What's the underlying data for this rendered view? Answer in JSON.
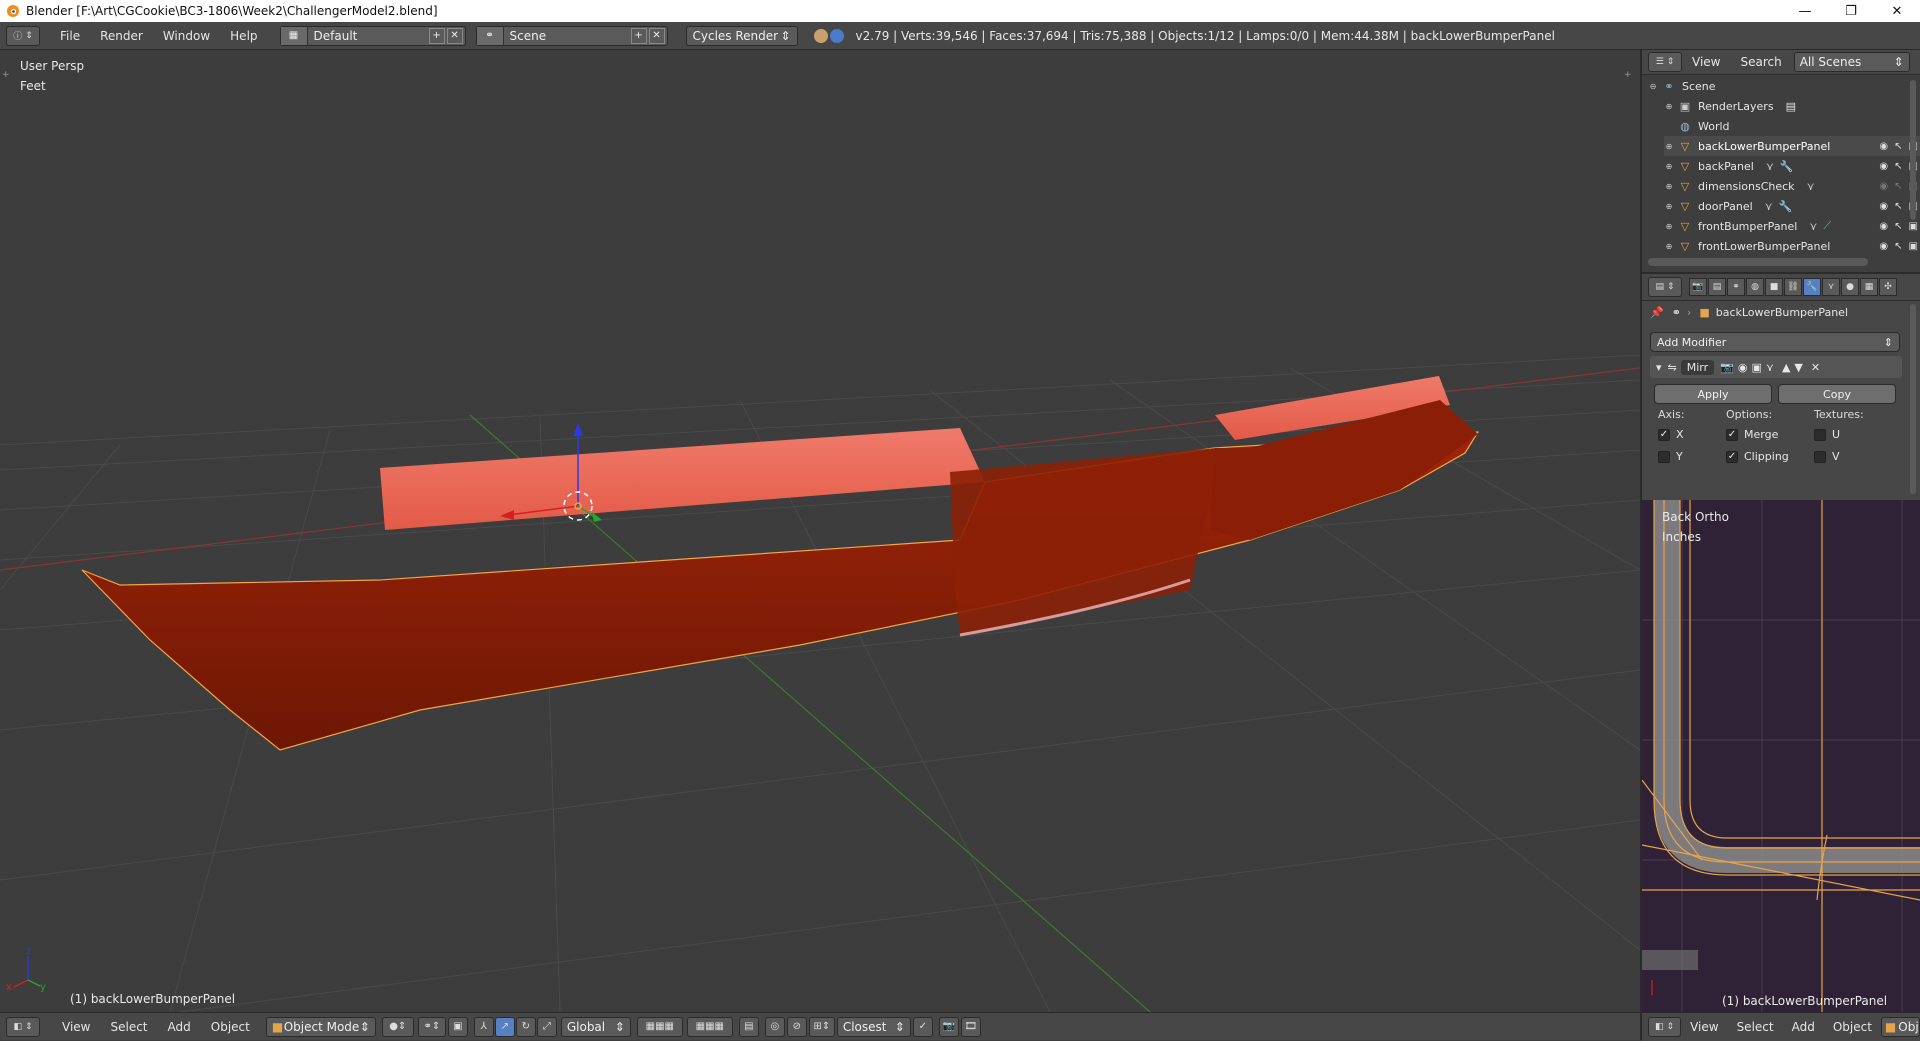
{
  "window": {
    "title": "Blender [F:\\Art\\CGCookie\\BC3-1806\\Week2\\ChallengerModel2.blend]",
    "controls": [
      "—",
      "❐",
      "✕"
    ]
  },
  "info_header": {
    "menus": [
      "File",
      "Render",
      "Window",
      "Help"
    ],
    "screen_layout": "Default",
    "scene": "Scene",
    "render_engine": "Cycles Render",
    "stats": "v2.79 | Verts:39,546 | Faces:37,694 | Tris:75,388 | Objects:1/12 | Lamps:0/0 | Mem:44.38M | backLowerBumperPanel"
  },
  "viewport": {
    "view_name": "User Persp",
    "units": "Feet",
    "active_object_label": "(1) backLowerBumperPanel",
    "axis_x": "x",
    "axis_y": "y",
    "axis_z": "z",
    "colors": {
      "background": "#3d3d3d",
      "mesh": "#8a1e06",
      "mesh_light": "#e86757",
      "selection_outline": "#f2a446",
      "grid": "#4a4a4a",
      "x_axis": "#8a3434",
      "y_axis": "#3d7a2e"
    }
  },
  "bottom_header": {
    "menus": [
      "View",
      "Select",
      "Add",
      "Object"
    ],
    "mode": "Object Mode",
    "orientation": "Global",
    "snap": "Closest"
  },
  "outliner": {
    "menus": [
      "View",
      "Search"
    ],
    "filter": "All Scenes",
    "items": [
      {
        "label": "Scene",
        "type": "scene"
      },
      {
        "label": "RenderLayers",
        "type": "renderlayers"
      },
      {
        "label": "World",
        "type": "world"
      },
      {
        "label": "backLowerBumperPanel",
        "type": "mesh"
      },
      {
        "label": "backPanel",
        "type": "mesh"
      },
      {
        "label": "dimensionsCheck",
        "type": "mesh"
      },
      {
        "label": "doorPanel",
        "type": "mesh"
      },
      {
        "label": "frontBumperPanel",
        "type": "mesh"
      },
      {
        "label": "frontLowerBumperPanel",
        "type": "mesh"
      }
    ]
  },
  "properties": {
    "object_name": "backLowerBumperPanel",
    "add_modifier": "Add Modifier",
    "modifier_name": "Mirr",
    "apply": "Apply",
    "copy": "Copy",
    "axis_label": "Axis:",
    "options_label": "Options:",
    "textures_label": "Textures:",
    "axis_x": "X",
    "axis_y": "Y",
    "merge": "Merge",
    "clipping": "Clipping",
    "tex_u": "U",
    "tex_v": "V",
    "checks": {
      "x": true,
      "y": false,
      "merge": true,
      "clipping": true,
      "u": false,
      "v": false
    }
  },
  "side_viewport": {
    "view_name": "Back Ortho",
    "units": "Inches",
    "active_object_label": "(1) backLowerBumperPanel",
    "menus": [
      "View",
      "Select",
      "Add",
      "Object"
    ],
    "truncated_button": "Obje"
  }
}
